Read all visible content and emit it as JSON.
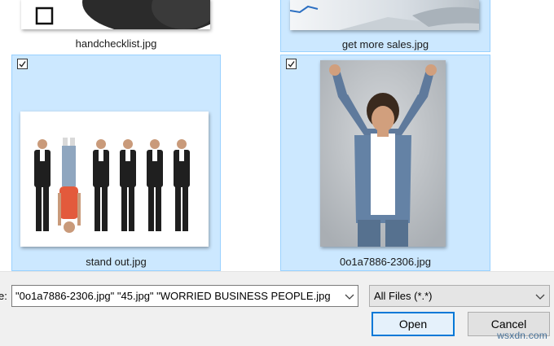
{
  "files": [
    {
      "name": "handchecklist.jpg",
      "selected": false,
      "icon": "hand-checklist-thumbnail"
    },
    {
      "name": "get more sales.jpg",
      "selected": true,
      "icon": "sales-chart-thumbnail"
    },
    {
      "name": "stand out.jpg",
      "selected": true,
      "checked": true,
      "icon": "businessmen-lineup-thumbnail"
    },
    {
      "name": "0o1a7886-2306.jpg",
      "selected": true,
      "checked": true,
      "icon": "celebrating-man-thumbnail"
    }
  ],
  "footer": {
    "filename_label": "e:",
    "filename_value": "\"0o1a7886-2306.jpg\" \"45.jpg\" \"WORRIED BUSINESS PEOPLE.jpg",
    "filetype_value": "All Files (*.*)",
    "open_label": "Open",
    "cancel_label": "Cancel"
  },
  "watermark": "wsxdn.com",
  "colors": {
    "selection_bg": "#cce8ff",
    "selection_border": "#99d1ff",
    "focus_border": "#0078d7",
    "dialog_bg": "#f0f0f0"
  }
}
